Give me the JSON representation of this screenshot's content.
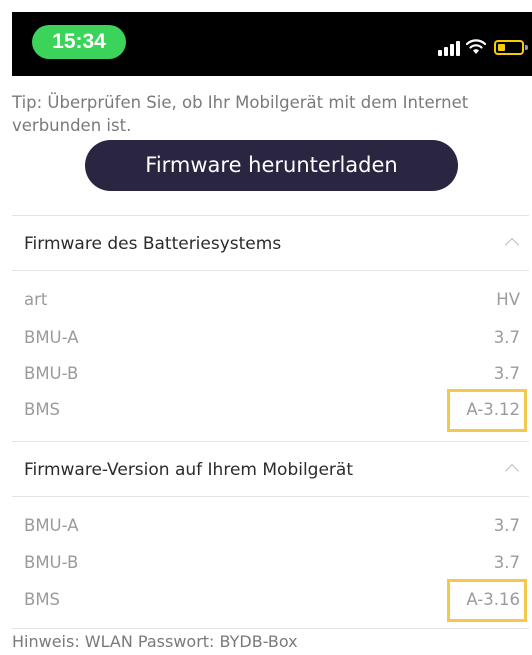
{
  "status_bar": {
    "time": "15:34",
    "icons": [
      "signal-icon",
      "wifi-icon",
      "battery-icon"
    ],
    "colors": {
      "background": "#000000",
      "time_pill": "#3bd359",
      "battery": "#f5cf00"
    }
  },
  "tip": "Tip: Überprüfen Sie, ob Ihr Mobilgerät mit dem Internet verbunden ist.",
  "download_button": "Firmware herunterladen",
  "battery_system": {
    "title": "Firmware des Batteriesystems",
    "rows": [
      {
        "label": "art",
        "value": "HV"
      },
      {
        "label": "BMU-A",
        "value": "3.7"
      },
      {
        "label": "BMU-B",
        "value": "3.7"
      },
      {
        "label": "BMS",
        "value": "A-3.12"
      }
    ]
  },
  "mobile_device": {
    "title": "Firmware-Version auf Ihrem Mobilgerät",
    "rows": [
      {
        "label": "BMU-A",
        "value": "3.7"
      },
      {
        "label": "BMU-B",
        "value": "3.7"
      },
      {
        "label": "BMS",
        "value": "A-3.16"
      }
    ]
  },
  "footer": "Hinweis: WLAN Passwort: BYDB-Box",
  "colors": {
    "button": "#2a2541",
    "highlight": "#f2c94c"
  }
}
